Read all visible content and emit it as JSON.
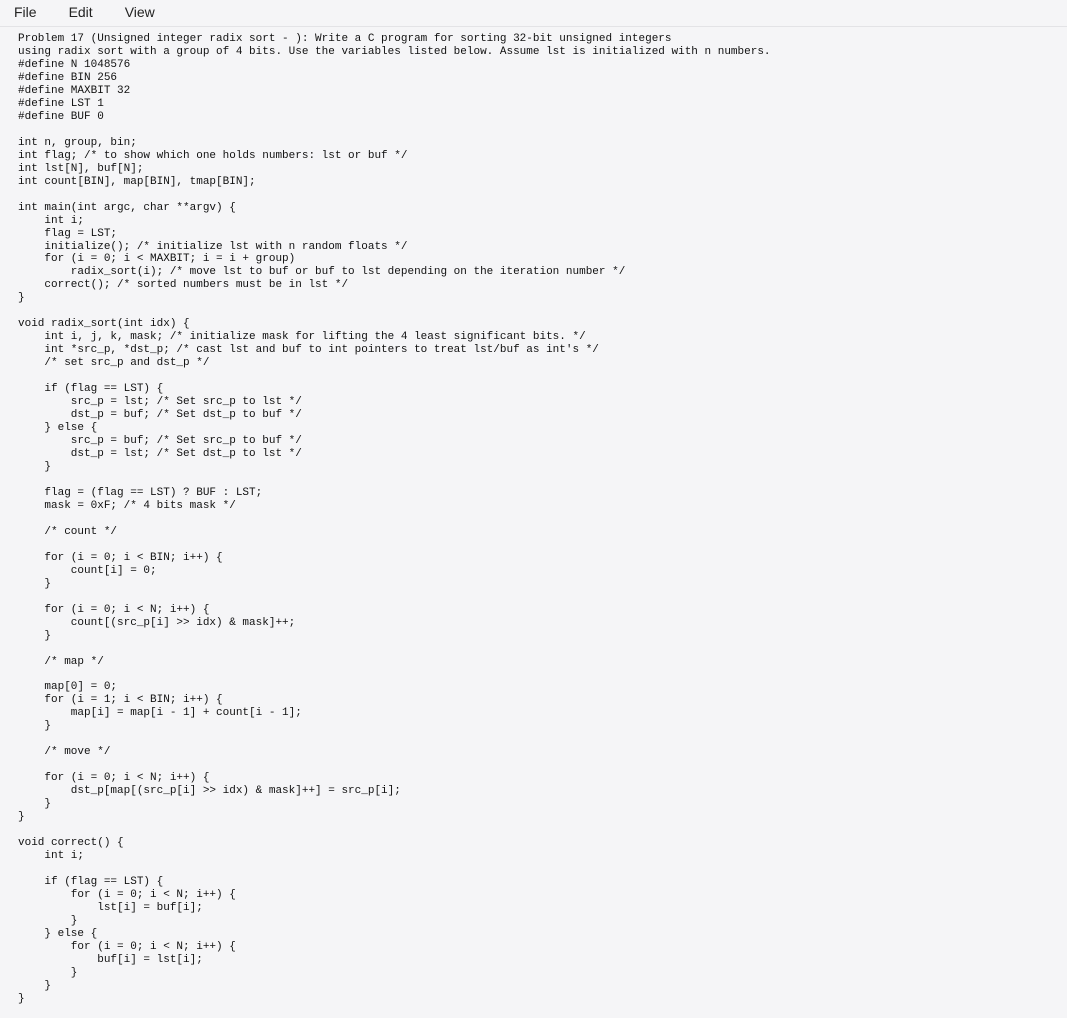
{
  "menu": {
    "file": "File",
    "edit": "Edit",
    "view": "View"
  },
  "code": "Problem 17 (Unsigned integer radix sort - ): Write a C program for sorting 32-bit unsigned integers\nusing radix sort with a group of 4 bits. Use the variables listed below. Assume lst is initialized with n numbers.\n#define N 1048576\n#define BIN 256\n#define MAXBIT 32\n#define LST 1\n#define BUF 0\n\nint n, group, bin;\nint flag; /* to show which one holds numbers: lst or buf */\nint lst[N], buf[N];\nint count[BIN], map[BIN], tmap[BIN];\n\nint main(int argc, char **argv) {\n    int i;\n    flag = LST;\n    initialize(); /* initialize lst with n random floats */\n    for (i = 0; i < MAXBIT; i = i + group)\n        radix_sort(i); /* move lst to buf or buf to lst depending on the iteration number */\n    correct(); /* sorted numbers must be in lst */\n}\n\nvoid radix_sort(int idx) {\n    int i, j, k, mask; /* initialize mask for lifting the 4 least significant bits. */\n    int *src_p, *dst_p; /* cast lst and buf to int pointers to treat lst/buf as int's */\n    /* set src_p and dst_p */\n\n    if (flag == LST) {\n        src_p = lst; /* Set src_p to lst */\n        dst_p = buf; /* Set dst_p to buf */\n    } else {\n        src_p = buf; /* Set src_p to buf */\n        dst_p = lst; /* Set dst_p to lst */\n    }\n\n    flag = (flag == LST) ? BUF : LST;\n    mask = 0xF; /* 4 bits mask */\n\n    /* count */\n\n    for (i = 0; i < BIN; i++) {\n        count[i] = 0;\n    }\n\n    for (i = 0; i < N; i++) {\n        count[(src_p[i] >> idx) & mask]++;\n    }\n\n    /* map */\n\n    map[0] = 0;\n    for (i = 1; i < BIN; i++) {\n        map[i] = map[i - 1] + count[i - 1];\n    }\n\n    /* move */\n\n    for (i = 0; i < N; i++) {\n        dst_p[map[(src_p[i] >> idx) & mask]++] = src_p[i];\n    }\n}\n\nvoid correct() {\n    int i;\n\n    if (flag == LST) {\n        for (i = 0; i < N; i++) {\n            lst[i] = buf[i];\n        }\n    } else {\n        for (i = 0; i < N; i++) {\n            buf[i] = lst[i];\n        }\n    }\n}"
}
